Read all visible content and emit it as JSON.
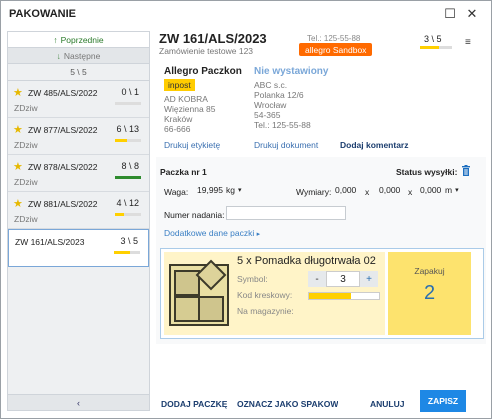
{
  "window": {
    "title": "PAKOWANIE",
    "restore_icon": "restore-icon",
    "close_icon": "close-icon"
  },
  "sidebar": {
    "prev_label": "Poprzednie",
    "next_label": "Następne",
    "position": "5 \\ 5",
    "orders": [
      {
        "number": "ZW 485/ALS/2022",
        "customer": "ZDziw",
        "count": "0 \\ 1",
        "starred": true,
        "progress": 0,
        "bar_color": "#ffd000"
      },
      {
        "number": "ZW 877/ALS/2022",
        "customer": "ZDziw",
        "count": "6 \\ 13",
        "starred": true,
        "progress": 0.45,
        "bar_color": "#ffd000"
      },
      {
        "number": "ZW 878/ALS/2022",
        "customer": "ZDziw",
        "count": "8 \\ 8",
        "starred": true,
        "progress": 1,
        "bar_color": "#2e8b2e"
      },
      {
        "number": "ZW 881/ALS/2022",
        "customer": "ZDziw",
        "count": "4 \\ 12",
        "starred": true,
        "progress": 0.33,
        "bar_color": "#ffd000"
      },
      {
        "number": "ZW 161/ALS/2023",
        "customer": "",
        "count": "3 \\ 5",
        "starred": false,
        "progress": 0.6,
        "bar_color": "#ffd000"
      }
    ],
    "collapse_label": "‹"
  },
  "header": {
    "order_number": "ZW 161/ALS/2023",
    "subtitle": "Zamówienie testowe 123",
    "phone": "Tel.: 125-55-88",
    "source_badge": "allegro Sandbox",
    "count": "3 \\ 5",
    "progress": 0.6,
    "menu_label": "≡"
  },
  "sender": {
    "name": "Allegro Paczkon",
    "carrier": "inpost",
    "lines": [
      "AD KOBRA",
      "Więzienna 85",
      "Kraków",
      "66-666"
    ],
    "print_label": "Drukuj etykietę"
  },
  "recipient": {
    "status": "Nie wystawiony",
    "lines": [
      "ABC s.c.",
      "Polanka 12/6",
      "Wrocław",
      "54-365",
      "Tel.: 125-55-88"
    ],
    "print_doc": "Drukuj dokument",
    "add_comment": "Dodaj komentarz"
  },
  "package": {
    "title": "Paczka nr 1",
    "status_label": "Status wysyłki:",
    "weight_label": "Waga:",
    "weight_value": "19,995",
    "weight_unit": "kg",
    "dims_label": "Wymiary:",
    "dim_x": "0,000",
    "dim_y": "0,000",
    "dim_z": "0,000",
    "dim_unit": "m",
    "times": "x",
    "tracking_label": "Numer nadania:",
    "tracking_value": "",
    "extra_label": "Dodatkowe dane paczki"
  },
  "product": {
    "name": "5 x Pomadka długotrwała 02",
    "symbol_label": "Symbol:",
    "barcode_label": "Kod kreskowy:",
    "stock_label": "Na magazynie:",
    "quantity": "3",
    "minus": "-",
    "plus": "+",
    "scan_progress": 0.6,
    "packed_label": "Zapakuj",
    "packed_value": "2"
  },
  "footer": {
    "add_package": "DODAJ PACZKĘ",
    "mark_packed": "OZNACZ JAKO SPAKOWANE",
    "cancel": "ANULUJ",
    "save": "ZAPISZ"
  }
}
